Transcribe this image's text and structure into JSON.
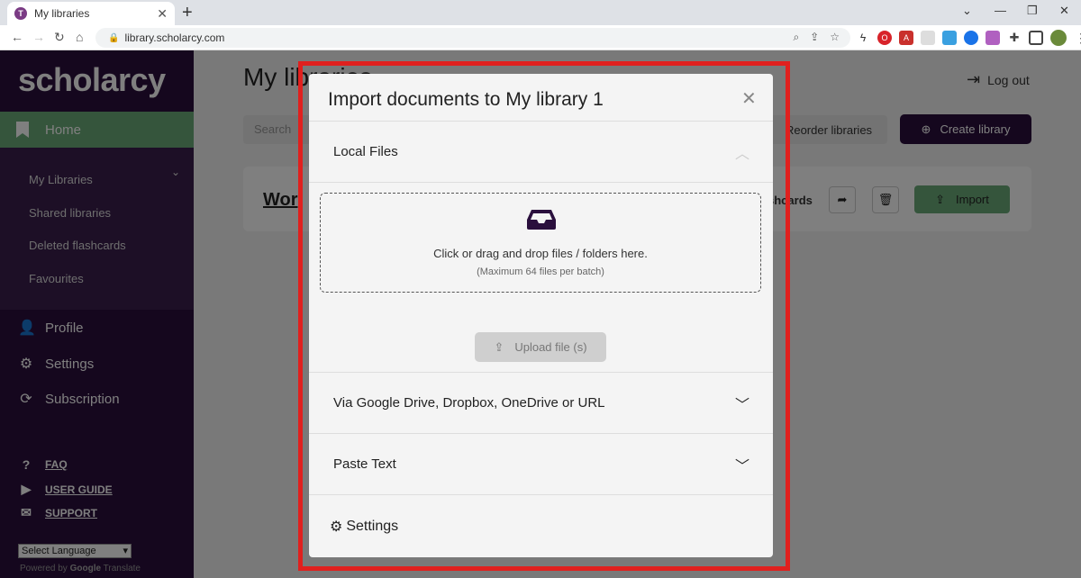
{
  "browser": {
    "tab_title": "My libraries",
    "tab_favicon": "T",
    "url": "library.scholarcy.com"
  },
  "sidebar": {
    "logo": "scholarcy",
    "home": "Home",
    "sub_items": [
      "My Libraries",
      "Shared libraries",
      "Deleted flashcards",
      "Favourites"
    ],
    "profile": "Profile",
    "settings": "Settings",
    "subscription": "Subscription",
    "faq": "FAQ",
    "user_guide": "USER GUIDE",
    "support": "SUPPORT",
    "language": "Select Language",
    "powered_prefix": "Powered by",
    "powered_brand": "Google",
    "powered_suffix": "Translate"
  },
  "main": {
    "title": "My libraries",
    "logout": "Log out",
    "search_placeholder": "Search",
    "reorder": "Reorder libraries",
    "create": "Create library",
    "library_name": "Wor",
    "flashcards": "shcards",
    "import": "Import"
  },
  "modal": {
    "title": "Import documents to My library 1",
    "local_files": "Local Files",
    "drop_text": "Click or drag and drop files / folders here.",
    "drop_sub": "(Maximum 64 files per batch)",
    "upload": "Upload file (s)",
    "cloud": "Via Google Drive, Dropbox, OneDrive or URL",
    "paste": "Paste Text",
    "settings": "Settings"
  },
  "colors": {
    "brand_dark": "#2a0f3d",
    "accent_green": "#6aaa78",
    "highlight_red": "#e0201e"
  }
}
